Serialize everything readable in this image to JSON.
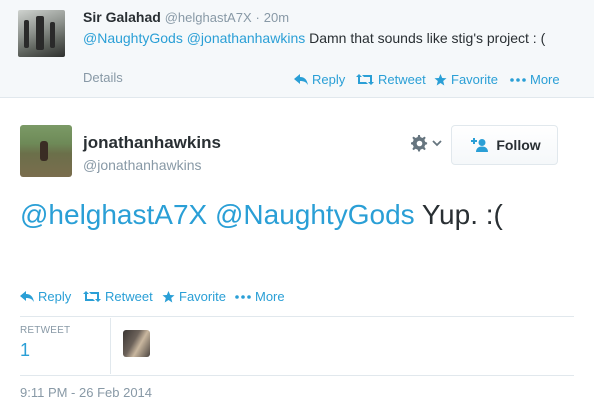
{
  "top_tweet": {
    "name": "Sir Galahad",
    "handle": "@helghastA7X",
    "separator": "·",
    "time": "20m",
    "mention_1": "@NaughtyGods",
    "mention_2": "@jonathanhawkins",
    "text": " Damn that sounds like stig's project : (",
    "details_label": "Details",
    "actions": {
      "reply": "Reply",
      "retweet": "Retweet",
      "favorite": "Favorite",
      "more": "More"
    }
  },
  "main_tweet": {
    "name": "jonathanhawkins",
    "handle": "@jonathanhawkins",
    "follow_label": "Follow",
    "mention_1": "@helghastA7X",
    "mention_2": "@NaughtyGods",
    "text": " Yup. :(",
    "actions": {
      "reply": "Reply",
      "retweet": "Retweet",
      "favorite": "Favorite",
      "more": "More"
    },
    "stats": {
      "retweet_label": "RETWEET",
      "retweet_count": "1"
    },
    "timestamp": "9:11 PM - 26 Feb 2014"
  },
  "colors": {
    "link": "#2a9fd6",
    "muted": "#8899a6",
    "text": "#292f33",
    "top_background": "#f5f8fa"
  },
  "icons": [
    "reply-icon",
    "retweet-icon",
    "favorite-icon",
    "more-icon",
    "gear-icon",
    "chevron-down-icon",
    "add-person-icon"
  ]
}
